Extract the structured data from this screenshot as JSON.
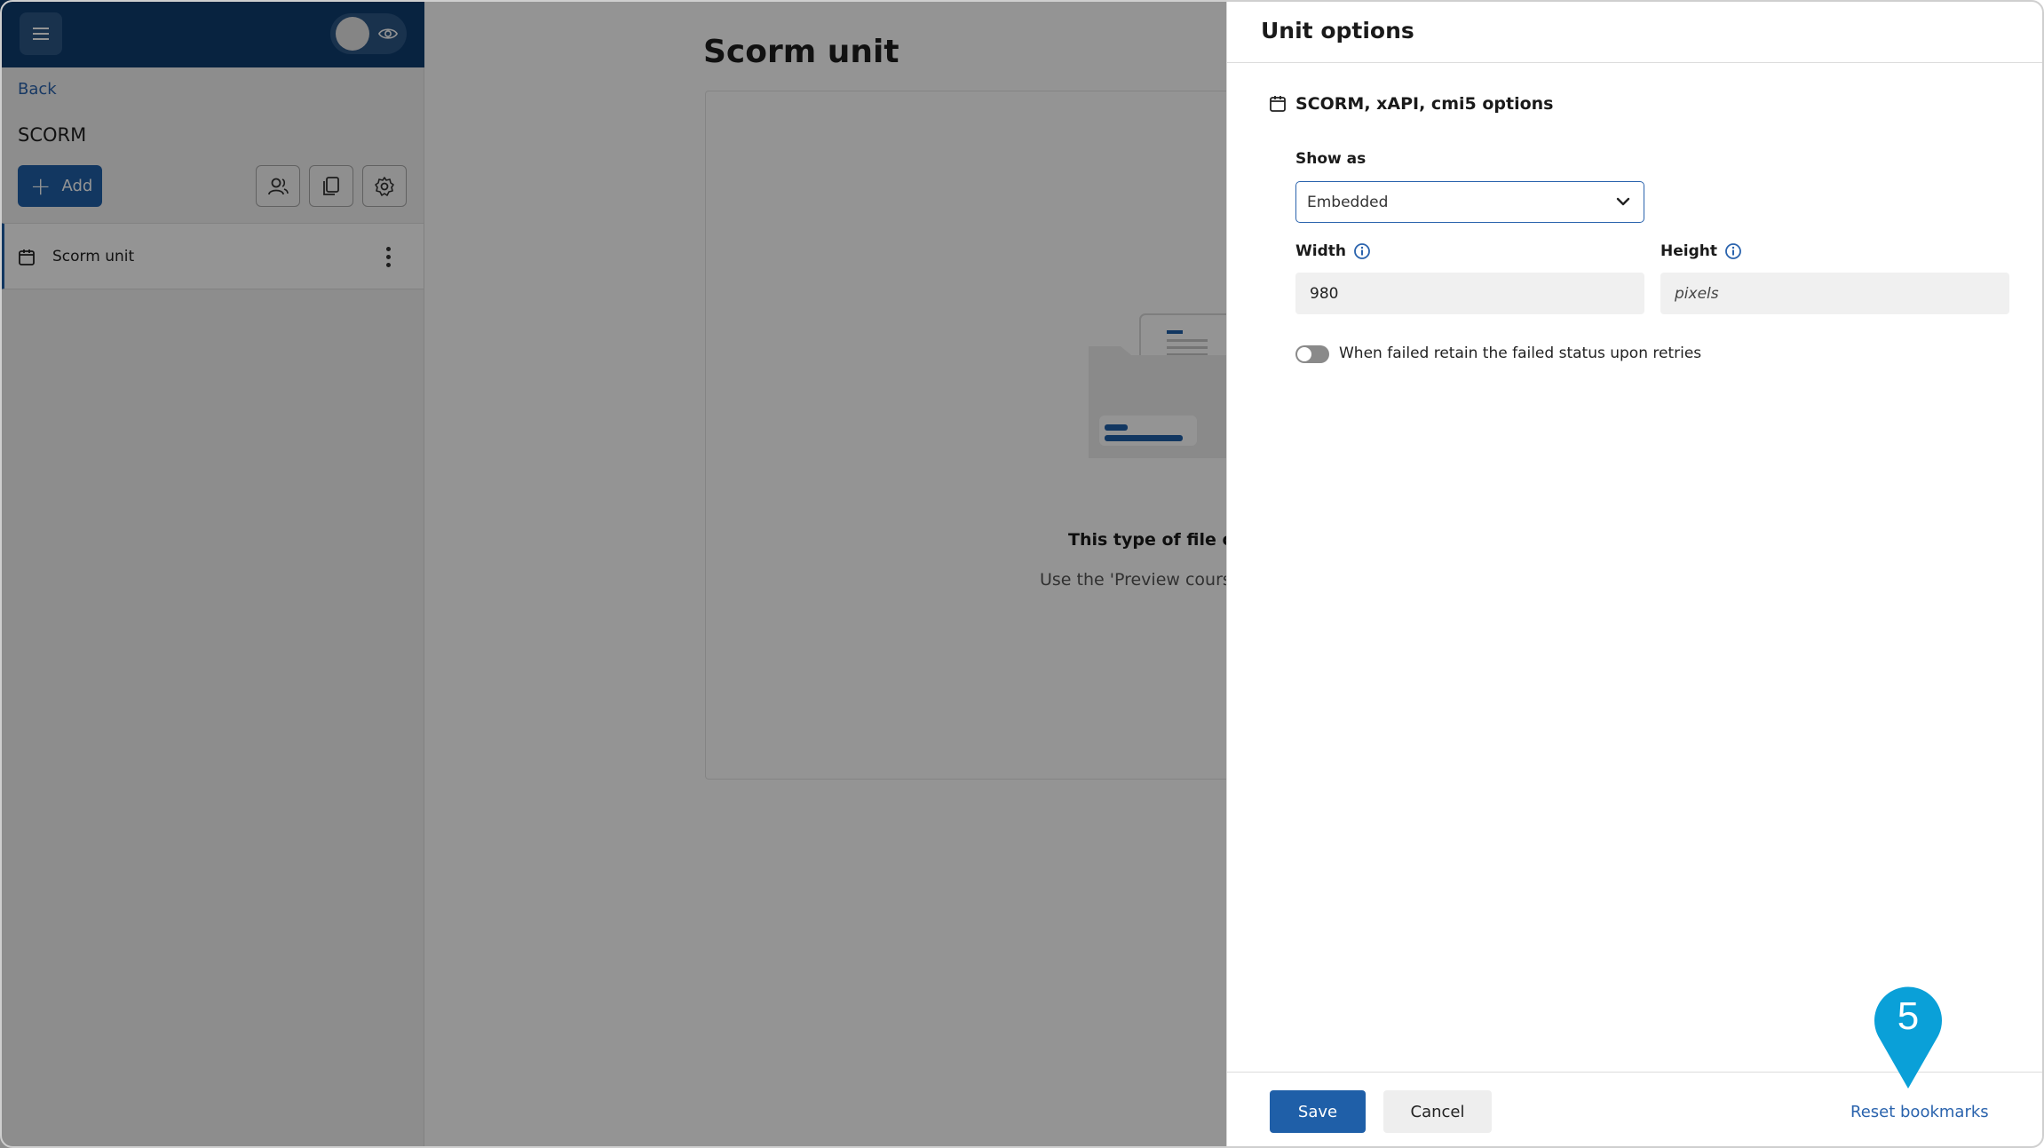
{
  "sidebar": {
    "back_label": "Back",
    "title": "SCORM",
    "add_label": "Add",
    "units": [
      {
        "label": "Scorm unit"
      }
    ]
  },
  "main": {
    "title": "Scorm unit",
    "message_title": "This type of file can",
    "message_sub": "Use the 'Preview course"
  },
  "panel": {
    "title": "Unit options",
    "section_title": "SCORM, xAPI, cmi5 options",
    "show_as_label": "Show as",
    "show_as_value": "Embedded",
    "width_label": "Width",
    "width_value": "980",
    "height_label": "Height",
    "height_placeholder": "pixels",
    "retain_toggle_label": "When failed retain the failed status upon retries",
    "retain_toggle_on": false,
    "save_label": "Save",
    "cancel_label": "Cancel",
    "reset_label": "Reset bookmarks"
  },
  "step_marker": {
    "number": "5"
  },
  "colors": {
    "topbar": "#0f3d6e",
    "primary": "#1f5fa8",
    "link": "#2a63ad",
    "marker": "#0aa0d8"
  },
  "icons": {
    "menu": "hamburger-icon",
    "preview": "eye-icon",
    "users": "users-icon",
    "copy": "copy-icon",
    "settings": "gear-icon",
    "unit": "scorm-package-icon",
    "info": "info-icon"
  }
}
